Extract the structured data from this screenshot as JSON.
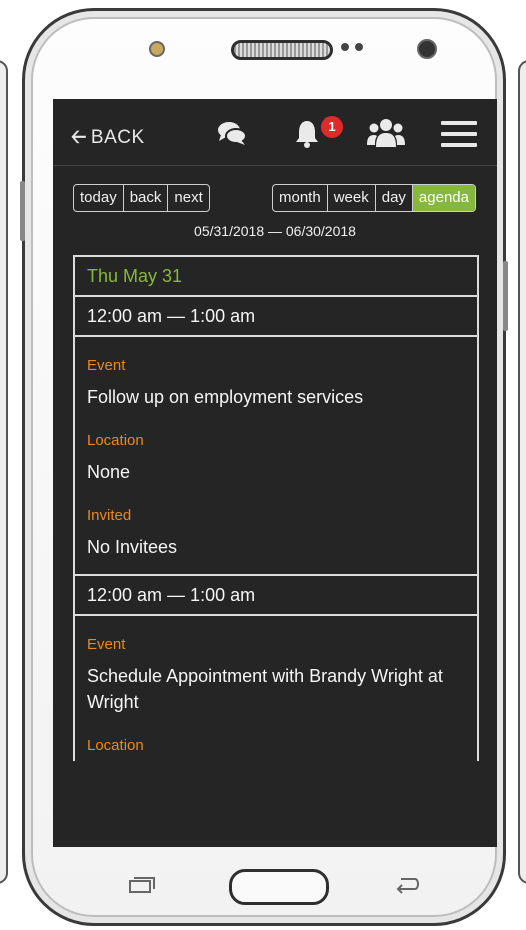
{
  "topbar": {
    "back_label": "BACK",
    "notification_count": "1",
    "icons": [
      "arrow-left-icon",
      "chat-icon",
      "bell-icon",
      "group-icon",
      "hamburger-menu-icon"
    ]
  },
  "calendar": {
    "nav_buttons": [
      "today",
      "back",
      "next"
    ],
    "view_buttons": [
      "month",
      "week",
      "day",
      "agenda"
    ],
    "active_view": "agenda",
    "date_range": "05/31/2018 — 06/30/2018"
  },
  "agenda": {
    "day_header": "Thu May 31",
    "events": [
      {
        "time": "12:00 am — 1:00 am",
        "event_label": "Event",
        "event_value": "Follow up on employment services",
        "location_label": "Location",
        "location_value": "None",
        "invited_label": "Invited",
        "invited_value": "No Invitees"
      },
      {
        "time": "12:00 am — 1:00 am",
        "event_label": "Event",
        "event_value": "Schedule Appointment with Brandy Wright at Wright",
        "location_label": "Location"
      }
    ]
  },
  "colors": {
    "screen_bg": "#252525",
    "accent_green": "#86b83e",
    "label_orange": "#e98a1e",
    "badge_red": "#e02a2a"
  }
}
